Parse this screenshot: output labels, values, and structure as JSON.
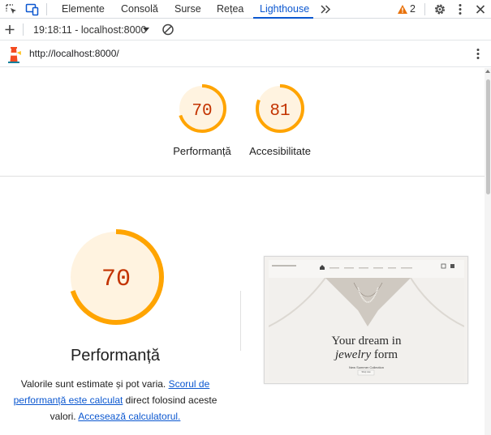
{
  "toolbar": {
    "tabs": [
      {
        "label": "Elemente",
        "active": false
      },
      {
        "label": "Consolă",
        "active": false
      },
      {
        "label": "Surse",
        "active": false
      },
      {
        "label": "Rețea",
        "active": false
      },
      {
        "label": "Lighthouse",
        "active": true
      }
    ],
    "overflow_icon": "double-chevron-right-icon",
    "warning_count": "2",
    "icons": [
      "inspect-element-icon",
      "device-toggle-icon",
      "warning-icon",
      "gear-icon",
      "more-vert-icon",
      "close-icon"
    ]
  },
  "report_bar": {
    "selected_report": "19:18:11 - localhost:8000",
    "icons": [
      "plus-icon",
      "dropdown-triangle-icon",
      "clear-icon"
    ]
  },
  "url_bar": {
    "url": "http://localhost:8000/",
    "icons": [
      "lighthouse-logo-icon",
      "more-vert-icon"
    ]
  },
  "summary_gauges": [
    {
      "label": "Performanță",
      "score": "70",
      "fraction": 0.7
    },
    {
      "label": "Accesibilitate",
      "score": "81",
      "fraction": 0.81
    }
  ],
  "main": {
    "score": "70",
    "fraction": 0.7,
    "title": "Performanță",
    "desc_before": "Valorile sunt estimate și pot varia. ",
    "desc_link1": "Scorul de performanță este calculat",
    "desc_middle": " direct folosind aceste valori. ",
    "desc_link2": "Accesează calculatorul."
  },
  "thumbnail": {
    "headline_line1": "Your dream in",
    "headline_line2_italic": "jewelry",
    "headline_line2_rest": " form",
    "subtext": "New Summer Collection",
    "button": "Shop now"
  },
  "colors": {
    "accent": "#0b57d0",
    "gauge_orange": "#ffa400",
    "gauge_fill": "#fff3e0",
    "score_text": "#c33300"
  }
}
